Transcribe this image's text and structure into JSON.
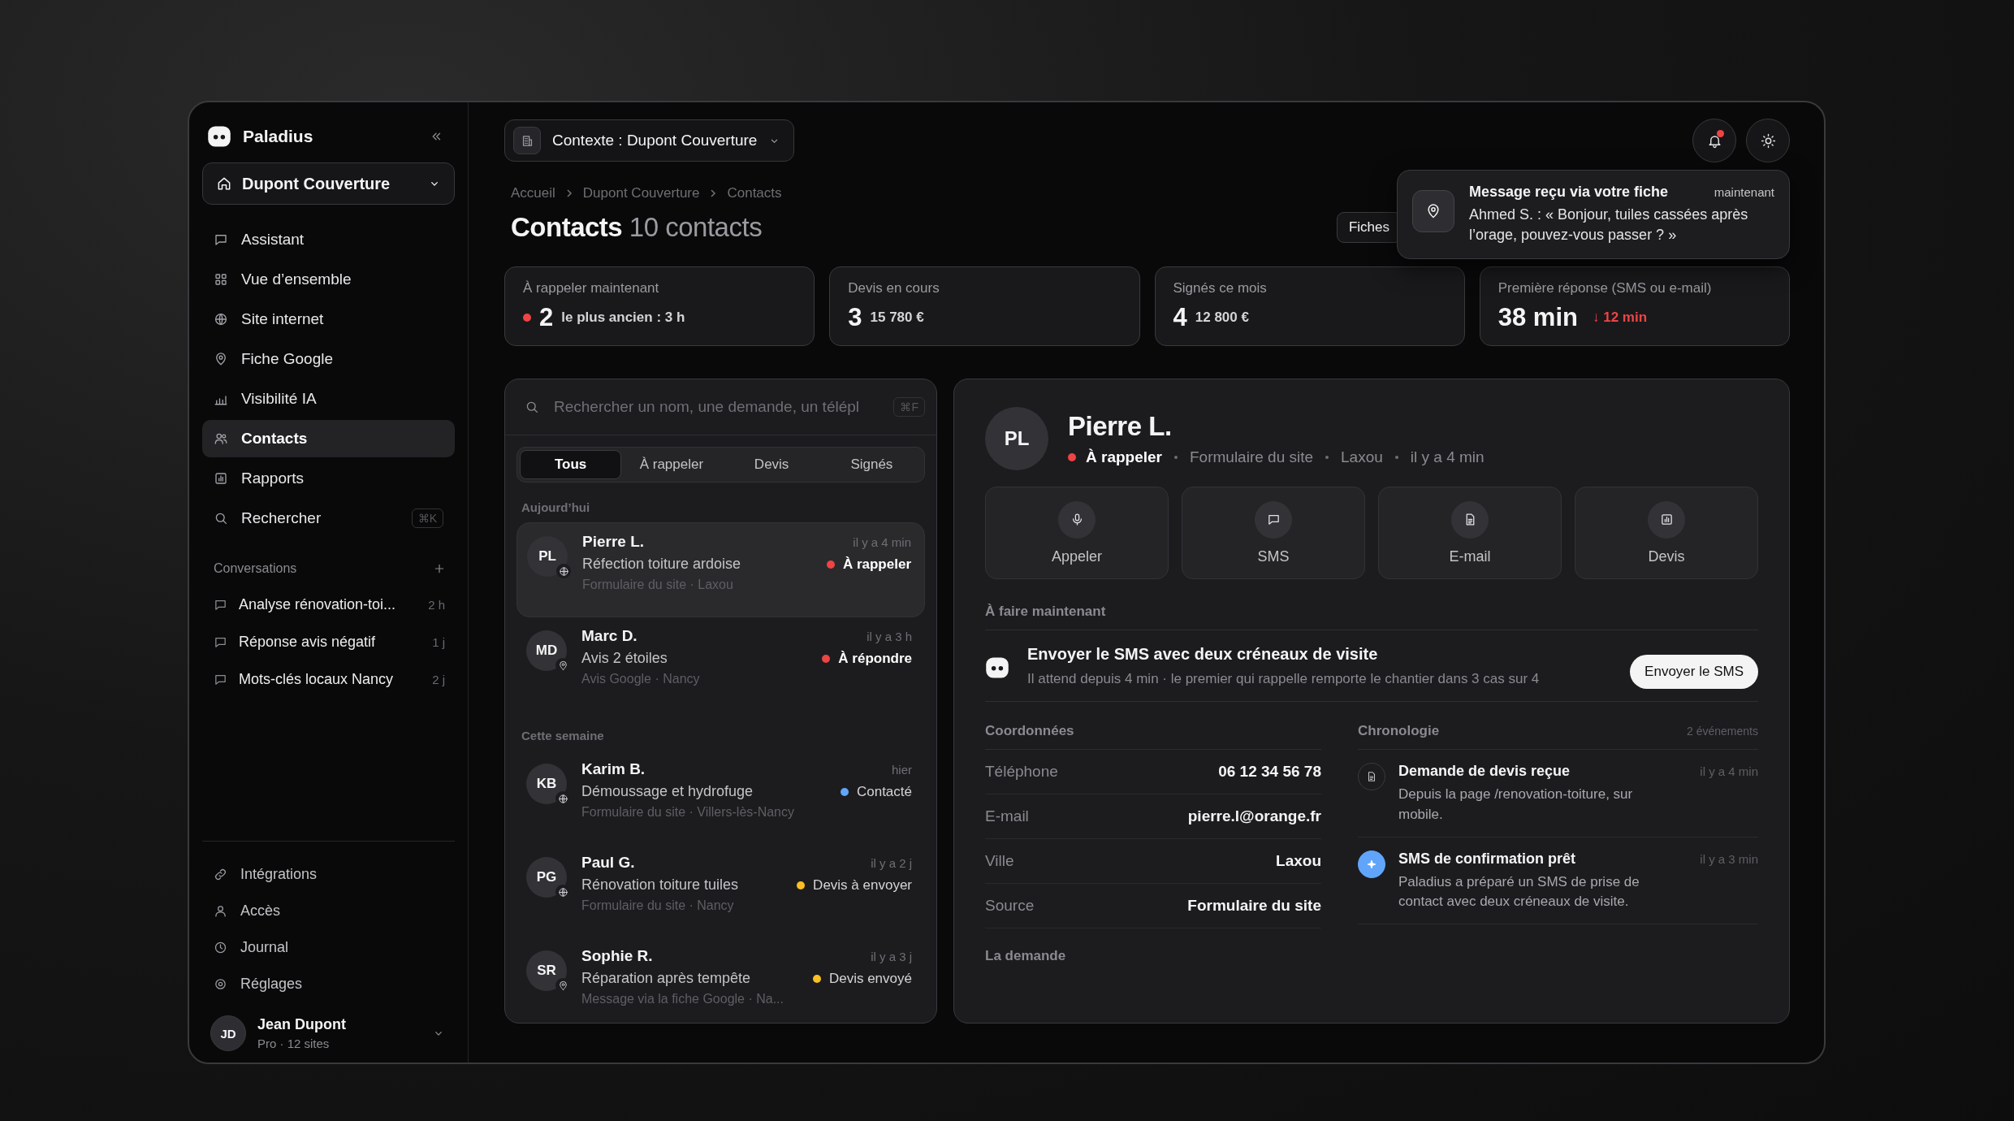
{
  "app": {
    "name": "Paladius"
  },
  "workspace": {
    "label": "Dupont Couverture"
  },
  "nav": [
    {
      "label": "Assistant",
      "selected": false
    },
    {
      "label": "Vue d’ensemble",
      "selected": false
    },
    {
      "label": "Site internet",
      "selected": false
    },
    {
      "label": "Fiche Google",
      "selected": false
    },
    {
      "label": "Visibilité IA",
      "selected": false
    },
    {
      "label": "Contacts",
      "selected": true
    },
    {
      "label": "Rapports",
      "selected": false
    },
    {
      "label": "Rechercher",
      "selected": false,
      "shortcut": "⌘K"
    }
  ],
  "conversations": {
    "title": "Conversations",
    "items": [
      {
        "label": "Analyse rénovation-toi...",
        "age": "2 h"
      },
      {
        "label": "Réponse avis négatif",
        "age": "1 j"
      },
      {
        "label": "Mots-clés locaux Nancy",
        "age": "2 j"
      }
    ]
  },
  "footer_nav": [
    {
      "label": "Intégrations"
    },
    {
      "label": "Accès"
    },
    {
      "label": "Journal"
    },
    {
      "label": "Réglages"
    }
  ],
  "user": {
    "initials": "JD",
    "name": "Jean Dupont",
    "plan": "Pro · 12 sites"
  },
  "context": {
    "label": "Contexte : Dupont Couverture"
  },
  "notifications": {
    "unread": true
  },
  "breadcrumb": [
    "Accueil",
    "Dupont Couverture",
    "Contacts"
  ],
  "title": "Contacts",
  "count": "10 contacts",
  "fiches_button": "Fiches",
  "toast": {
    "title": "Message reçu via votre fiche",
    "time": "maintenant",
    "body": "Ahmed S. : « Bonjour, tuiles cassées après l’orage, pouvez-vous passer ? »"
  },
  "stats": [
    {
      "label": "À rappeler maintenant",
      "value": "2",
      "detail": "le plus ancien : 3 h",
      "alert": true
    },
    {
      "label": "Devis en cours",
      "value": "3",
      "detail": "15 780 €",
      "alert": false
    },
    {
      "label": "Signés ce mois",
      "value": "4",
      "detail": "12 800 €",
      "alert": false
    },
    {
      "label": "Première réponse (SMS ou e-mail)",
      "value": "38 min",
      "trend": "↓ 12 min",
      "alert": false
    }
  ],
  "search": {
    "placeholder": "Rechercher un nom, une demande, un télépl",
    "shortcut": "⌘F"
  },
  "filters": [
    {
      "label": "Tous",
      "selected": true
    },
    {
      "label": "À rappeler",
      "selected": false
    },
    {
      "label": "Devis",
      "selected": false
    },
    {
      "label": "Signés",
      "selected": false
    }
  ],
  "groups": [
    {
      "title": "Aujourd’hui",
      "contacts": [
        {
          "initials": "PL",
          "kind": "site",
          "name": "Pierre L.",
          "time": "il y a 4 min",
          "request": "Réfection toiture ardoise",
          "meta": "Formulaire du site · Laxou",
          "status": "À rappeler",
          "color": "#ef4444",
          "urgent": true,
          "selected": true
        },
        {
          "initials": "MD",
          "kind": "google",
          "name": "Marc D.",
          "time": "il y a 3 h",
          "request": "Avis 2 étoiles",
          "meta": "Avis Google · Nancy",
          "status": "À répondre",
          "color": "#ef4444",
          "urgent": true,
          "selected": false
        }
      ]
    },
    {
      "title": "Cette semaine",
      "contacts": [
        {
          "initials": "KB",
          "kind": "site",
          "name": "Karim B.",
          "time": "hier",
          "request": "Démoussage et hydrofuge",
          "meta": "Formulaire du site · Villers-lès-Nancy",
          "status": "Contacté",
          "color": "#60a5fa",
          "urgent": false,
          "selected": false
        },
        {
          "initials": "PG",
          "kind": "site",
          "name": "Paul G.",
          "time": "il y a 2 j",
          "request": "Rénovation toiture tuiles",
          "meta": "Formulaire du site · Nancy",
          "status": "Devis à envoyer",
          "color": "#fbbf24",
          "urgent": false,
          "selected": false
        },
        {
          "initials": "SR",
          "kind": "google",
          "name": "Sophie R.",
          "time": "il y a 3 j",
          "request": "Réparation après tempête",
          "meta": "Message via la fiche Google · Na...",
          "status": "Devis envoyé",
          "color": "#fbbf24",
          "urgent": false,
          "selected": false
        }
      ]
    }
  ],
  "detail": {
    "initials": "PL",
    "name": "Pierre L.",
    "status": "À rappeler",
    "color": "#ef4444",
    "meta": [
      "Formulaire du site",
      "Laxou",
      "il y a 4 min"
    ],
    "actions": [
      {
        "label": "Appeler"
      },
      {
        "label": "SMS"
      },
      {
        "label": "E-mail"
      },
      {
        "label": "Devis"
      }
    ],
    "todo": {
      "title": "À faire maintenant",
      "task": "Envoyer le SMS avec deux créneaux de visite",
      "note": "Il attend depuis 4 min · le premier qui rappelle remporte le chantier dans 3 cas sur 4",
      "button": "Envoyer le SMS"
    },
    "coords": {
      "title": "Coordonnées",
      "rows": [
        {
          "label": "Téléphone",
          "value": "06 12 34 56 78"
        },
        {
          "label": "E-mail",
          "value": "pierre.l@orange.fr"
        },
        {
          "label": "Ville",
          "value": "Laxou"
        },
        {
          "label": "Source",
          "value": "Formulaire du site"
        }
      ]
    },
    "timeline": {
      "title": "Chronologie",
      "count": "2 événements",
      "events": [
        {
          "kind": "doc",
          "title": "Demande de devis reçue",
          "time": "il y a 4 min",
          "text": "Depuis la page /renovation-toiture, sur mobile."
        },
        {
          "kind": "ai",
          "title": "SMS de confirmation prêt",
          "time": "il y a 3 min",
          "text": "Paladius a préparé un SMS de prise de contact avec deux créneaux de visite."
        }
      ]
    },
    "request_title": "La demande"
  }
}
